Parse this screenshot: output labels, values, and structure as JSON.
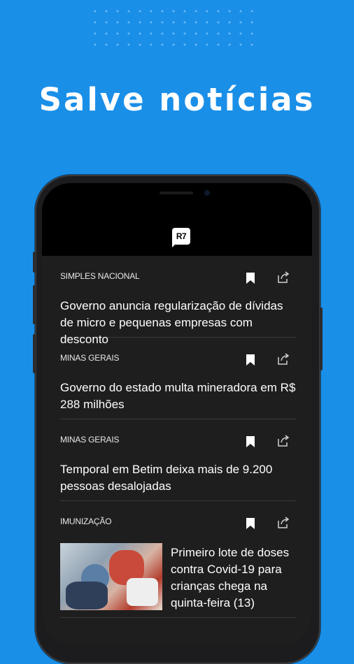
{
  "promo": {
    "headline": "Salve notícias"
  },
  "app": {
    "logo_text": "R7"
  },
  "colors": {
    "background": "#1a8fe8",
    "feed_background": "#1e1e1e",
    "text": "#ffffff"
  },
  "feed": {
    "items": [
      {
        "category": "SIMPLES NACIONAL",
        "title": "Governo anuncia regularização de dívidas de micro e pequenas empresas com desconto",
        "bookmark_icon": "bookmark-icon",
        "share_icon": "share-icon"
      },
      {
        "category": "MINAS GERAIS",
        "title": "Governo do estado multa mineradora em R$ 288 milhões",
        "bookmark_icon": "bookmark-icon",
        "share_icon": "share-icon"
      },
      {
        "category": "MINAS GERAIS",
        "title": "Temporal em Betim deixa mais de 9.200 pessoas desalojadas",
        "bookmark_icon": "bookmark-icon",
        "share_icon": "share-icon"
      },
      {
        "category": "IMUNIZAÇÃO",
        "title": "Primeiro lote de doses contra Covid-19 para crianças chega na quinta-feira (13)",
        "bookmark_icon": "bookmark-icon",
        "share_icon": "share-icon",
        "has_image": true
      }
    ]
  }
}
